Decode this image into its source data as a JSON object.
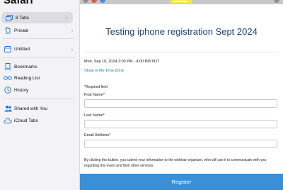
{
  "sidebar": {
    "title": "Safari",
    "items": [
      {
        "label": "8 Tabs",
        "icon": "tabs-icon",
        "chevron": "›",
        "selected": true
      },
      {
        "label": "Private",
        "icon": "hand-icon",
        "chevron": "›"
      },
      {
        "label": "Untitled",
        "icon": "tab-group-icon",
        "chevron": "›"
      },
      {
        "label": "Bookmarks",
        "icon": "bookmark-icon"
      },
      {
        "label": "Reading List",
        "icon": "glasses-icon"
      },
      {
        "label": "History",
        "icon": "clock-icon"
      },
      {
        "label": "Shared with You",
        "icon": "shared-icon"
      },
      {
        "label": "iCloud Tabs",
        "icon": "cloud-icon"
      }
    ]
  },
  "page": {
    "title": "Testing iphone registration Sept 2024",
    "date": "Mon, Sep 16, 2024 3:00 PM - 4:00 PM PDT",
    "timezone_link": "Show in My Time Zone",
    "required_note": "*Required field",
    "fields": [
      {
        "label": "First Name*",
        "value": ""
      },
      {
        "label": "Last Name*",
        "value": ""
      },
      {
        "label": "Email Address*",
        "value": ""
      }
    ],
    "consent": "By clicking this button, you submit your information to the webinar organizer, who will use it to communicate with you regarding this event and their other services.",
    "register_label": "Register"
  },
  "colors": {
    "accent": "#3a8fd6",
    "title": "#1c3f77",
    "link": "#1a73c9",
    "sidebar_bg": "#f2f2f7",
    "highlight": "#f2e94b"
  }
}
